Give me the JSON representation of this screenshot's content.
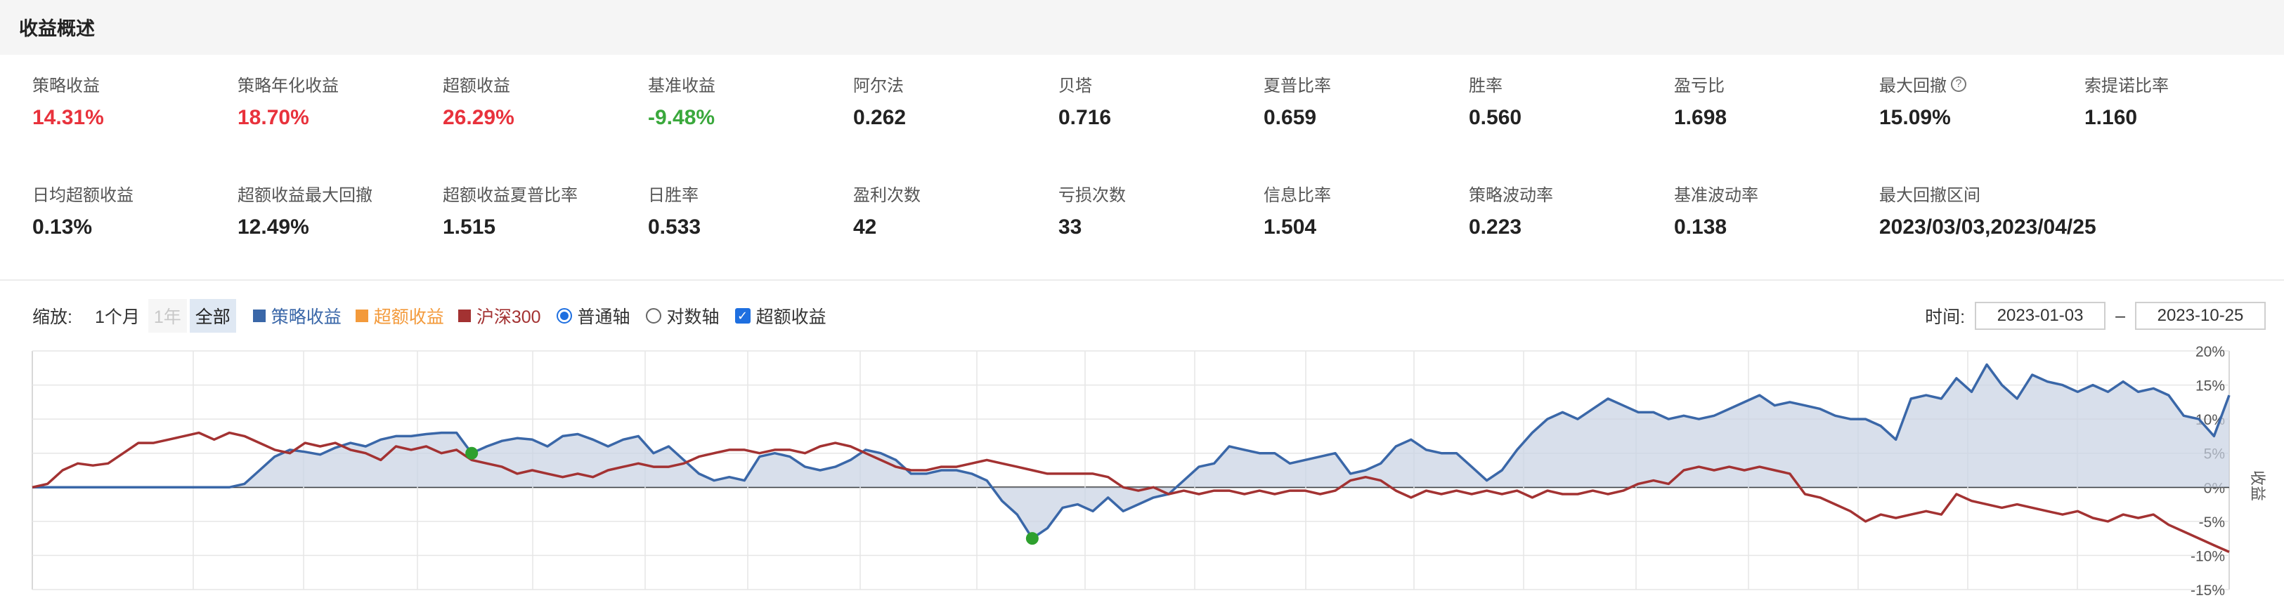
{
  "header": {
    "title": "收益概述"
  },
  "colors": {
    "up": "#e8323c",
    "down": "#3aa83c",
    "strategy": "#3a67a8",
    "excess": "#f39a3b",
    "benchmark": "#a33232",
    "accent": "#1e6fe0"
  },
  "metrics_row1": [
    {
      "label": "策略收益",
      "value": "14.31%",
      "tone": "up"
    },
    {
      "label": "策略年化收益",
      "value": "18.70%",
      "tone": "up"
    },
    {
      "label": "超额收益",
      "value": "26.29%",
      "tone": "up"
    },
    {
      "label": "基准收益",
      "value": "-9.48%",
      "tone": "down"
    },
    {
      "label": "阿尔法",
      "value": "0.262"
    },
    {
      "label": "贝塔",
      "value": "0.716"
    },
    {
      "label": "夏普比率",
      "value": "0.659"
    },
    {
      "label": "胜率",
      "value": "0.560"
    },
    {
      "label": "盈亏比",
      "value": "1.698"
    },
    {
      "label": "最大回撤",
      "value": "15.09%",
      "help": "?"
    },
    {
      "label": "索提诺比率",
      "value": "1.160"
    }
  ],
  "metrics_row2": [
    {
      "label": "日均超额收益",
      "value": "0.13%"
    },
    {
      "label": "超额收益最大回撤",
      "value": "12.49%"
    },
    {
      "label": "超额收益夏普比率",
      "value": "1.515"
    },
    {
      "label": "日胜率",
      "value": "0.533"
    },
    {
      "label": "盈利次数",
      "value": "42"
    },
    {
      "label": "亏损次数",
      "value": "33"
    },
    {
      "label": "信息比率",
      "value": "1.504"
    },
    {
      "label": "策略波动率",
      "value": "0.223"
    },
    {
      "label": "基准波动率",
      "value": "0.138"
    },
    {
      "label": "最大回撤区间",
      "value": "2023/03/03,2023/04/25"
    }
  ],
  "toolbar": {
    "zoom_label": "缩放:",
    "zoom_1m": "1个月",
    "zoom_1y": "1年",
    "zoom_all": "全部",
    "legend_strategy": "策略收益",
    "legend_excess": "超额收益",
    "legend_benchmark": "沪深300",
    "axis_normal": "普通轴",
    "axis_log": "对数轴",
    "excess_checkbox": "超额收益",
    "check_mark": "✓"
  },
  "time_range": {
    "label": "时间:",
    "start": "2023-01-03",
    "separator": "–",
    "end": "2023-10-25"
  },
  "chart_data": {
    "type": "line",
    "x_range": [
      "2023-01-03",
      "2023-10-25"
    ],
    "ylabel": "收益",
    "ylim": [
      -15,
      20
    ],
    "y_ticks": [
      "20%",
      "15%",
      "10%",
      "5%",
      "0%",
      "-5%",
      "-10%",
      "-15%"
    ],
    "series": [
      {
        "name": "策略收益",
        "color": "#3a67a8",
        "area": true,
        "values": [
          0,
          0,
          0,
          0,
          0,
          0,
          0,
          0,
          0,
          0,
          0,
          0,
          0,
          0,
          0.5,
          2.5,
          4.5,
          5.5,
          5.2,
          4.8,
          5.8,
          6.5,
          6.0,
          7.0,
          7.5,
          7.5,
          7.8,
          8.0,
          8.0,
          5.0,
          6.0,
          6.8,
          7.2,
          7.0,
          6.0,
          7.5,
          7.8,
          7.0,
          6.0,
          7.0,
          7.5,
          5.0,
          6.0,
          4.0,
          2.0,
          1.0,
          1.5,
          1.0,
          4.5,
          5.0,
          4.5,
          3.0,
          2.5,
          3.0,
          4.0,
          5.5,
          5.0,
          4.0,
          2.0,
          2.0,
          2.5,
          2.5,
          2.0,
          1.0,
          -2.0,
          -4.0,
          -7.5,
          -6.0,
          -3.0,
          -2.5,
          -3.5,
          -1.5,
          -3.5,
          -2.5,
          -1.5,
          -1.0,
          1.0,
          3.0,
          3.5,
          6.0,
          5.5,
          5.0,
          5.0,
          3.5,
          4.0,
          4.5,
          5.0,
          2.0,
          2.5,
          3.5,
          6.0,
          7.0,
          5.5,
          5.0,
          5.0,
          3.0,
          1.0,
          2.5,
          5.5,
          8.0,
          10.0,
          11.0,
          10.0,
          11.5,
          13.0,
          12.0,
          11.0,
          11.0,
          10.0,
          10.5,
          10.0,
          10.5,
          11.5,
          12.5,
          13.5,
          12.0,
          12.5,
          12.0,
          11.5,
          10.5,
          10.0,
          10.0,
          9.0,
          7.0,
          13.0,
          13.5,
          13.0,
          16.0,
          14.0,
          18.0,
          15.0,
          13.0,
          16.5,
          15.5,
          15.0,
          14.0,
          15.0,
          14.0,
          15.5,
          14.0,
          14.5,
          13.5,
          10.5,
          10.0,
          7.5,
          13.5
        ]
      },
      {
        "name": "超额收益",
        "color": "#f39a3b",
        "area": false,
        "values": []
      },
      {
        "name": "沪深300",
        "color": "#a33232",
        "area": false,
        "values": [
          0,
          0.5,
          2.5,
          3.5,
          3.2,
          3.5,
          5.0,
          6.5,
          6.5,
          7.0,
          7.5,
          8.0,
          7.0,
          8.0,
          7.5,
          6.5,
          5.5,
          5.0,
          6.5,
          6.0,
          6.5,
          5.5,
          5.0,
          4.0,
          6.0,
          5.5,
          6.0,
          5.0,
          5.5,
          4.0,
          3.5,
          3.0,
          2.0,
          2.5,
          2.0,
          1.5,
          2.0,
          1.5,
          2.5,
          3.0,
          3.5,
          3.0,
          3.0,
          3.5,
          4.5,
          5.0,
          5.5,
          5.5,
          5.0,
          5.5,
          5.5,
          5.0,
          6.0,
          6.5,
          6.0,
          5.0,
          4.0,
          3.0,
          2.5,
          2.5,
          3.0,
          3.0,
          3.5,
          4.0,
          3.5,
          3.0,
          2.5,
          2.0,
          2.0,
          2.0,
          2.0,
          1.5,
          0.0,
          -0.5,
          0.0,
          -1.0,
          -0.5,
          -1.0,
          -0.5,
          -0.5,
          -1.0,
          -0.5,
          -1.0,
          -0.5,
          -0.5,
          -1.0,
          -0.5,
          1.0,
          1.5,
          1.0,
          -0.5,
          -1.5,
          -0.5,
          -1.0,
          -0.5,
          -1.0,
          -0.5,
          -1.0,
          -0.5,
          -1.5,
          -0.5,
          -1.0,
          -1.0,
          -0.5,
          -1.0,
          -0.5,
          0.5,
          1.0,
          0.5,
          2.5,
          3.0,
          2.5,
          3.0,
          2.5,
          3.0,
          2.5,
          2.0,
          -1.0,
          -1.5,
          -2.5,
          -3.5,
          -5.0,
          -4.0,
          -4.5,
          -4.0,
          -3.5,
          -4.0,
          -1.0,
          -2.0,
          -2.5,
          -3.0,
          -2.5,
          -3.0,
          -3.5,
          -4.0,
          -3.5,
          -4.5,
          -5.0,
          -4.0,
          -4.5,
          -4.0,
          -5.5,
          -6.5,
          -7.5,
          -8.5,
          -9.48
        ]
      }
    ],
    "markers": [
      {
        "series": "策略收益",
        "index": 29,
        "color": "#2ea02e"
      },
      {
        "series": "策略收益",
        "index": 66,
        "color": "#2ea02e"
      }
    ]
  }
}
